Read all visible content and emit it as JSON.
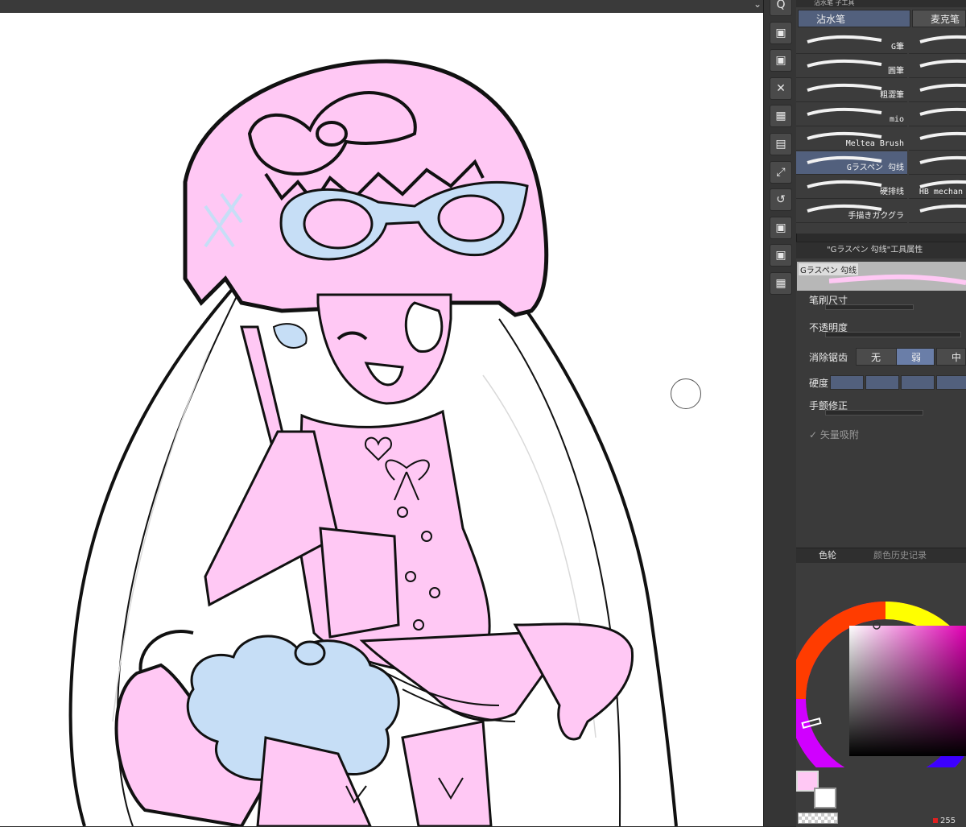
{
  "colors": {
    "canvas_bg": "#ffffff",
    "fill_pink": "#ffc8f4",
    "fill_blue": "#c6def6",
    "line": "#111111",
    "panel_bg": "#3c3c3c",
    "selected_row": "#52607d"
  },
  "topbar": {
    "chevron_icon": "⌄"
  },
  "icon_rail": {
    "buttons": [
      {
        "name": "quick-access-icon",
        "glyph": "Q"
      },
      {
        "name": "layer-icon-1",
        "glyph": "▣"
      },
      {
        "name": "layer-icon-2",
        "glyph": "▣"
      },
      {
        "name": "close-layer-icon",
        "glyph": "✕"
      },
      {
        "name": "material-icon",
        "glyph": "▦"
      },
      {
        "name": "navigator-icon",
        "glyph": "▤"
      },
      {
        "name": "transform-icon",
        "glyph": "⤢"
      },
      {
        "name": "auto-action-icon",
        "glyph": "↺"
      },
      {
        "name": "layer-property-icon",
        "glyph": "▣"
      },
      {
        "name": "history-icon",
        "glyph": "▣"
      },
      {
        "name": "grid-icon",
        "glyph": "▦"
      }
    ]
  },
  "sub_tool": {
    "header": "沾水笔 子工具",
    "tabs": [
      "沾水笔",
      "麦克笔"
    ],
    "brushes_left": [
      "G筆",
      "圓筆",
      "粗澀筆",
      "mio",
      "Meltea Brush",
      "Gラスペン 勾线",
      "硬排线",
      "手描きガクグラ"
    ],
    "brushes_right": [
      "",
      "",
      "",
      "",
      "",
      "",
      "HB mechan",
      ""
    ]
  },
  "tool_property": {
    "title": "\"Gラスペン 勾线\"工具属性",
    "preview_label": "Gラスペン 勾线",
    "brush_size_label": "笔刷尺寸",
    "opacity_label": "不透明度",
    "antialias_label": "消除锯齿",
    "antialias_options": [
      "无",
      "弱",
      "中"
    ],
    "hardness_label": "硬度",
    "stabilization_label": "手颤修正",
    "vector_snap_label": "矢量吸附",
    "vector_snap_checked": true
  },
  "color_panel": {
    "tabs": [
      "色轮",
      "颜色历史记录"
    ],
    "main_color": "#ffc8f4",
    "sub_color": "#ffffff",
    "red_value": "255"
  }
}
